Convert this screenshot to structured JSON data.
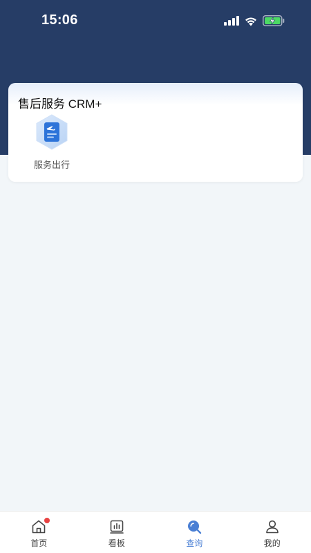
{
  "status_bar": {
    "time": "15:06",
    "icons": [
      "signal-icon",
      "wifi-icon",
      "battery-charging-icon"
    ]
  },
  "colors": {
    "header": "#263d66",
    "background": "#f2f6f9",
    "accent": "#4a7fd4",
    "badge": "#e84343"
  },
  "card": {
    "title": "售后服务 CRM+",
    "items": [
      {
        "label": "服务出行",
        "icon": "service-travel-icon"
      }
    ]
  },
  "tabbar": {
    "tabs": [
      {
        "label": "首页",
        "icon": "home-icon",
        "badge": true
      },
      {
        "label": "看板",
        "icon": "dashboard-icon"
      },
      {
        "label": "查询",
        "icon": "search-icon",
        "active": true
      },
      {
        "label": "我的",
        "icon": "user-icon"
      }
    ]
  }
}
